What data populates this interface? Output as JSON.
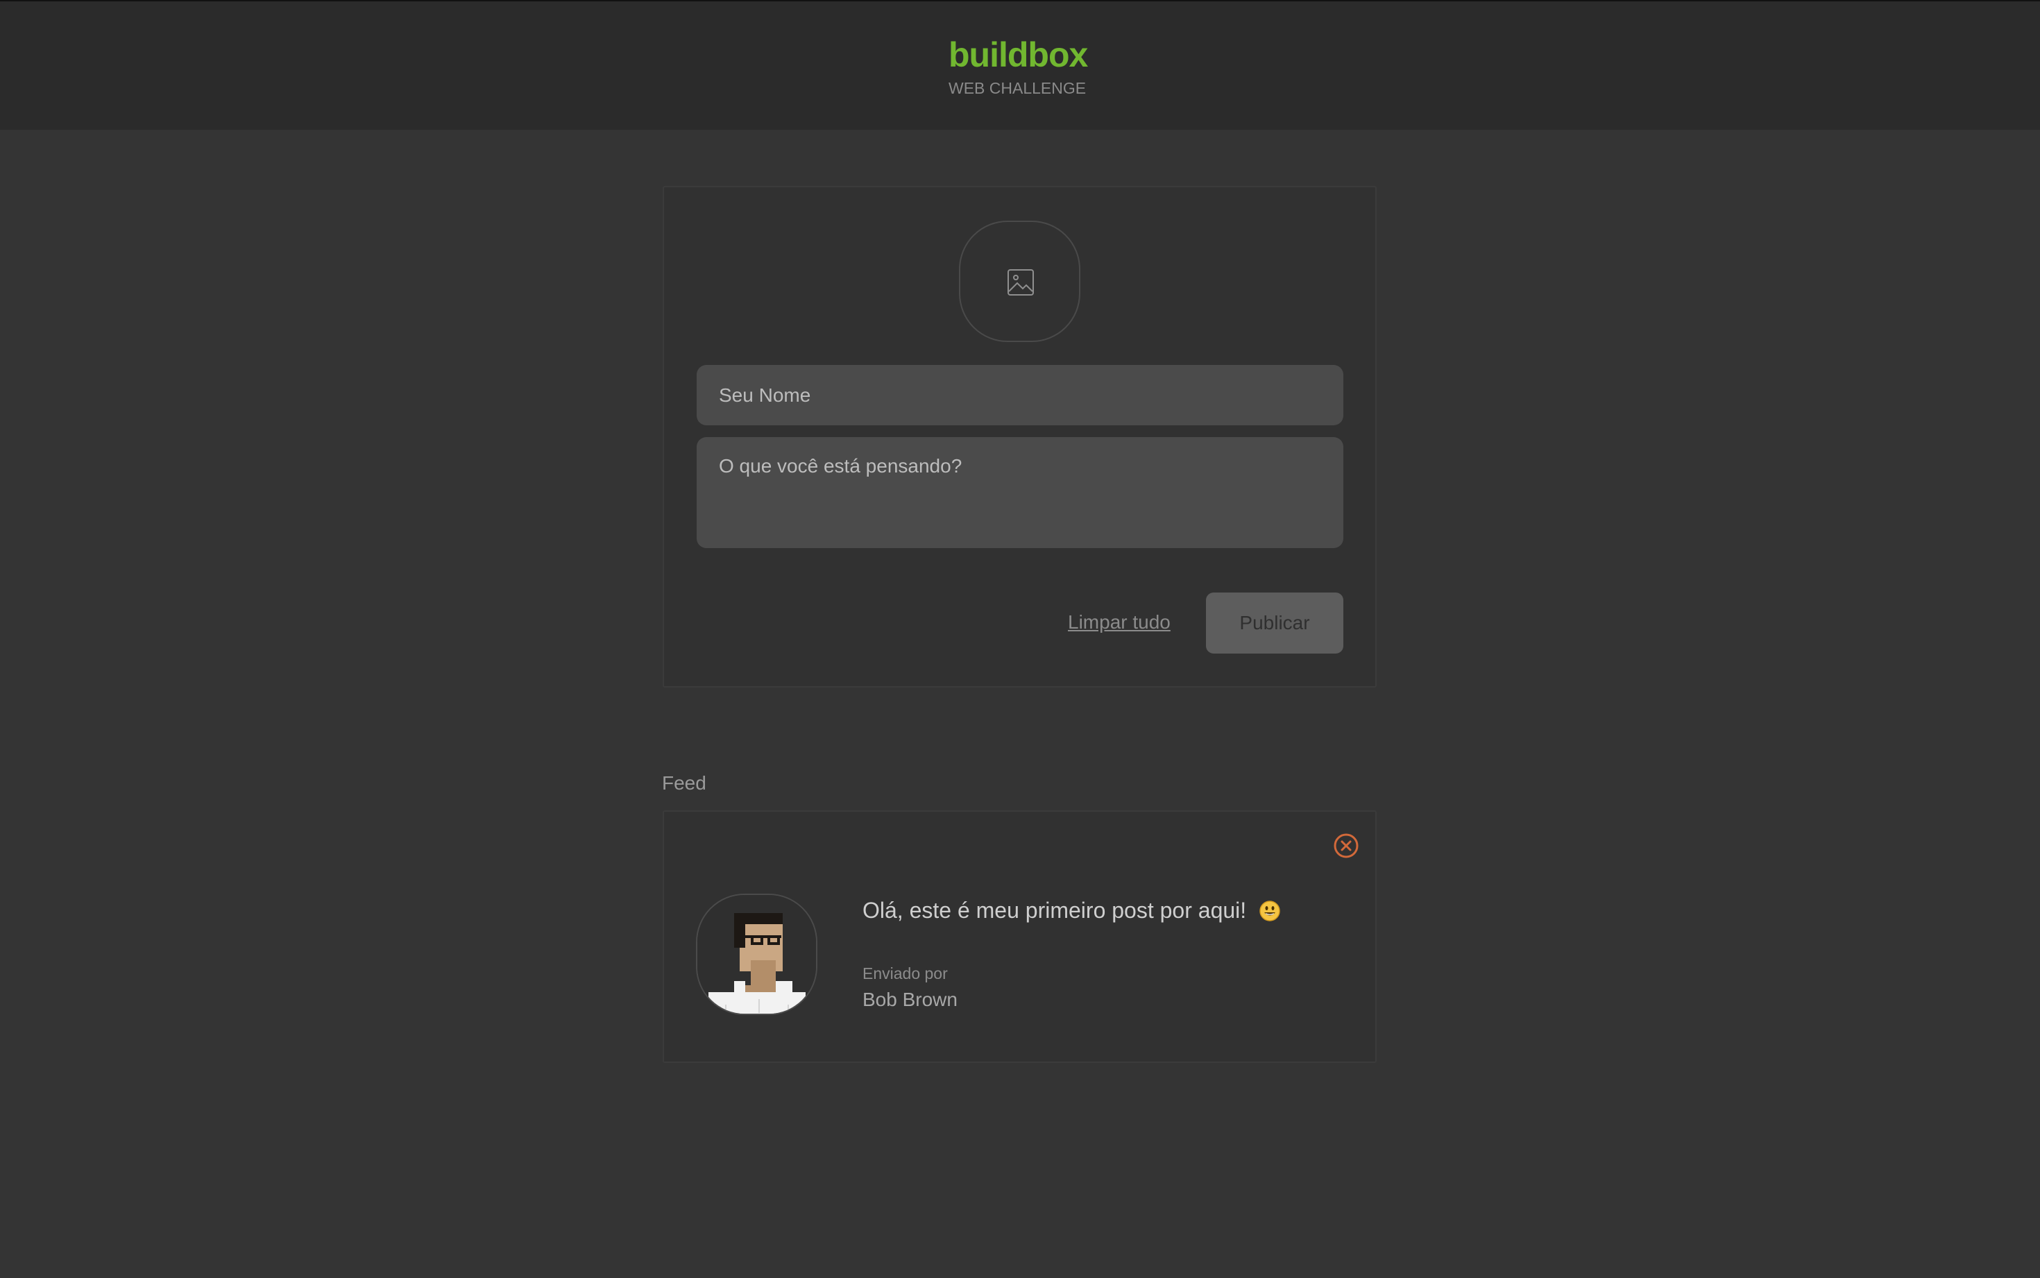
{
  "header": {
    "brand": "buildbox",
    "subtitle": "WEB CHALLENGE",
    "brand_color": "#71b730"
  },
  "composer": {
    "image_upload_icon": "image-icon",
    "name_placeholder": "Seu Nome",
    "name_value": "",
    "message_placeholder": "O que você está pensando?",
    "message_value": "",
    "clear_label": "Limpar tudo",
    "publish_label": "Publicar"
  },
  "feed": {
    "title": "Feed",
    "posts": [
      {
        "text": "Olá, este é meu primeiro post por aqui!",
        "emoji": "grinning-face-emoji",
        "sent_by_label": "Enviado por",
        "author": "Bob Brown",
        "avatar_icon": "pixel-person-avatar",
        "delete_icon": "close-circle-icon",
        "delete_color": "#d2693a"
      }
    ]
  }
}
